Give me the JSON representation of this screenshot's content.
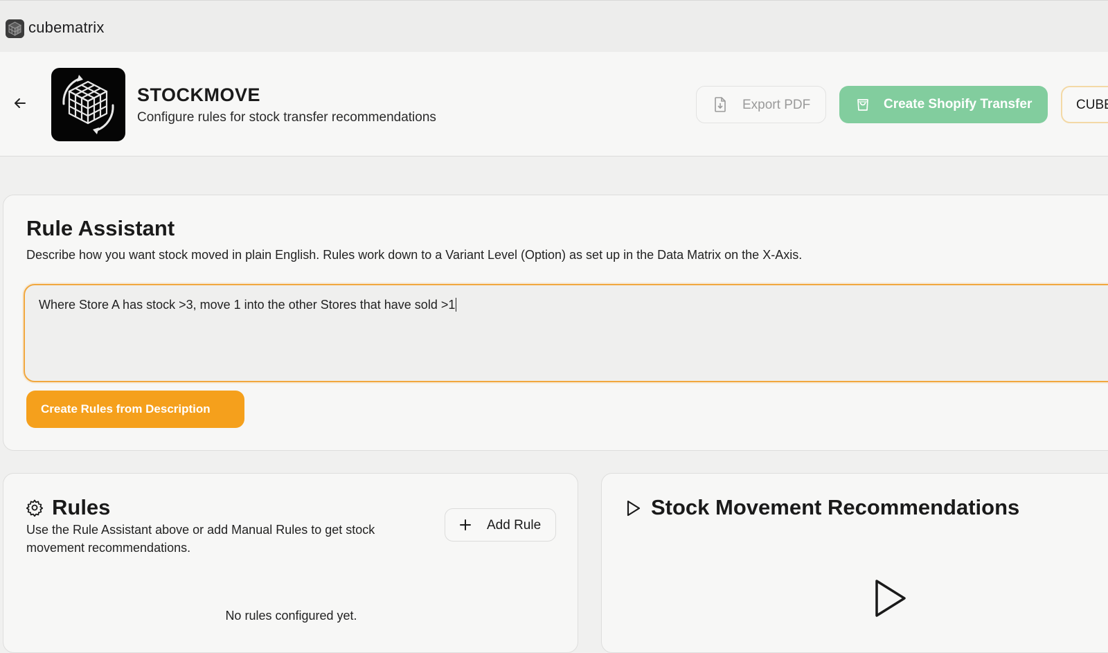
{
  "topbar": {
    "brand_name": "cubematrix",
    "brand_icon": "cube-logo-icon"
  },
  "header": {
    "back_icon": "arrow-left-icon",
    "app_icon": "rubiks-cube-logo",
    "title": "STOCKMOVE",
    "subtitle": "Configure rules for stock transfer recommendations",
    "buttons": {
      "export_label": "Export PDF",
      "export_icon": "file-download-icon",
      "shopify_label": "Create Shopify Transfer",
      "shopify_icon": "shopping-bag-icon",
      "cube_label": "CUBE"
    }
  },
  "assistant": {
    "title": "Rule Assistant",
    "description": "Describe how you want stock moved in plain English. Rules work down to a Variant Level (Option) as set up in the Data Matrix on the X-Axis.",
    "input_value": "Where Store A has stock >3, move 1 into the other Stores that have sold >1",
    "create_button_label": "Create Rules from Description"
  },
  "rules": {
    "icon": "gear-icon",
    "title": "Rules",
    "description": "Use the Rule Assistant above or add Manual Rules to get stock movement recommendations.",
    "add_button_label": "Add Rule",
    "add_icon": "plus-icon",
    "empty_text": "No rules configured yet."
  },
  "recommendations": {
    "icon": "play-icon",
    "title": "Stock Movement Recommendations",
    "placeholder_icon": "play-large-icon"
  },
  "colors": {
    "accent_orange": "#f5a01c",
    "shopify_green": "#82cd9e",
    "input_border": "#f1a73e"
  }
}
